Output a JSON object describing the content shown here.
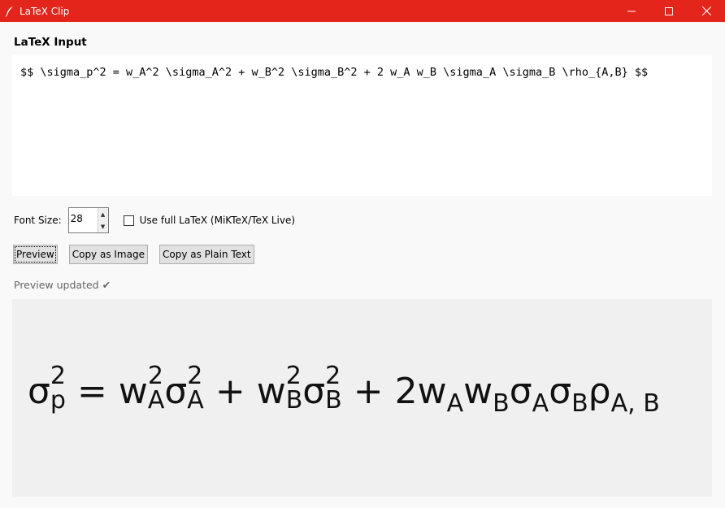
{
  "window": {
    "title": "LaTeX Clip",
    "controls": {
      "minimize": "—",
      "maximize": "☐",
      "close": "✕"
    }
  },
  "input": {
    "section_title": "LaTeX Input",
    "text": "$$ \\sigma_p^2 = w_A^2 \\sigma_A^2 + w_B^2 \\sigma_B^2 + 2 w_A w_B \\sigma_A \\sigma_B \\rho_{A,B} $$"
  },
  "options": {
    "font_size_label": "Font Size:",
    "font_size_value": "28",
    "full_latex_label": "Use full LaTeX (MiKTeX/TeX Live)",
    "full_latex_checked": false
  },
  "buttons": {
    "preview": "Preview",
    "copy_image": "Copy as Image",
    "copy_text": "Copy as Plain Text"
  },
  "status": "Preview updated ✔",
  "formula": {
    "sigma": "σ",
    "w": "w",
    "rho": "ρ",
    "two": "2",
    "p": "p",
    "A": "A",
    "B": "B",
    "AB": "A, B",
    "eq": "=",
    "plus": "+"
  }
}
